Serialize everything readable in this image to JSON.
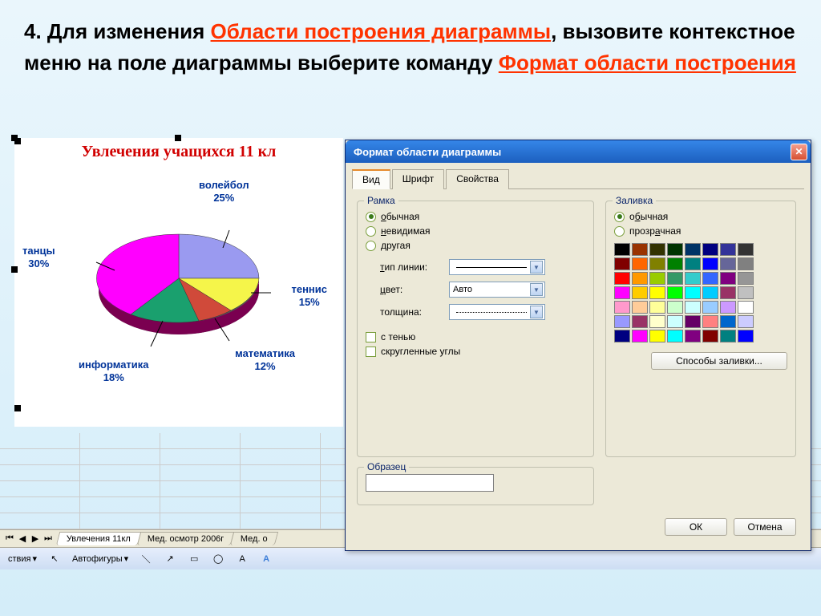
{
  "instruction": {
    "part1": "4. Для изменения ",
    "link1": "Области построения диаграммы",
    "part2": ", вызовите контекстное меню на поле диаграммы выберите команду ",
    "link2": "Формат области построения"
  },
  "chart": {
    "title": "Увлечения учащихся 11 кл"
  },
  "chart_data": {
    "type": "pie",
    "title": "Увлечения учащихся 11 кл",
    "series": [
      {
        "name": "волейбол",
        "value": 25,
        "label": "волейбол\n25%",
        "color": "#9a9af0"
      },
      {
        "name": "теннис",
        "value": 15,
        "label": "теннис\n15%",
        "color": "#f5f54a"
      },
      {
        "name": "математика",
        "value": 12,
        "label": "математика\n12%",
        "color": "#d04a3a"
      },
      {
        "name": "информатика",
        "value": 18,
        "label": "информатика\n18%",
        "color": "#1aa06e"
      },
      {
        "name": "танцы",
        "value": 30,
        "label": "танцы\n30%",
        "color": "#ff00ff"
      }
    ]
  },
  "sheets": {
    "tab1": "Увлечения 11кл",
    "tab2": "Мед. осмотр 2006г",
    "tab3": "Мед. о"
  },
  "toolbar": {
    "actions": "ствия",
    "autoshapes": "Автофигуры"
  },
  "dialog": {
    "title": "Формат области диаграммы",
    "tabs": {
      "view": "Вид",
      "font": "Шрифт",
      "props": "Свойства"
    },
    "frame": {
      "group": "Рамка",
      "normal": "обычная",
      "normal_u": "о",
      "invisible": "невидимая",
      "invisible_u": "н",
      "other": "другая",
      "line_type": "тип линии:",
      "line_type_u": "т",
      "color": "цвет:",
      "color_u": "ц",
      "color_val": "Авто",
      "weight": "толщина:",
      "shadow": "с тенью",
      "rounded": "скругленные углы"
    },
    "fill": {
      "group": "Заливка",
      "normal": "обычная",
      "normal_u": "б",
      "transparent": "прозрачная",
      "methods": "Способы заливки..."
    },
    "sample": "Образец",
    "ok": "ОК",
    "cancel": "Отмена",
    "palette": [
      "#000000",
      "#993300",
      "#333300",
      "#003300",
      "#003366",
      "#000080",
      "#333399",
      "#333333",
      "#800000",
      "#ff6600",
      "#808000",
      "#008000",
      "#008080",
      "#0000ff",
      "#666699",
      "#808080",
      "#ff0000",
      "#ff9900",
      "#99cc00",
      "#339966",
      "#33cccc",
      "#3366ff",
      "#800080",
      "#969696",
      "#ff00ff",
      "#ffcc00",
      "#ffff00",
      "#00ff00",
      "#00ffff",
      "#00ccff",
      "#993366",
      "#c0c0c0",
      "#ff99cc",
      "#ffcc99",
      "#ffff99",
      "#ccffcc",
      "#ccffff",
      "#99ccff",
      "#cc99ff",
      "#ffffff",
      "#9999ff",
      "#993366",
      "#ffffcc",
      "#ccffff",
      "#660066",
      "#ff8080",
      "#0066cc",
      "#ccccff",
      "#000080",
      "#ff00ff",
      "#ffff00",
      "#00ffff",
      "#800080",
      "#800000",
      "#008080",
      "#0000ff"
    ]
  }
}
